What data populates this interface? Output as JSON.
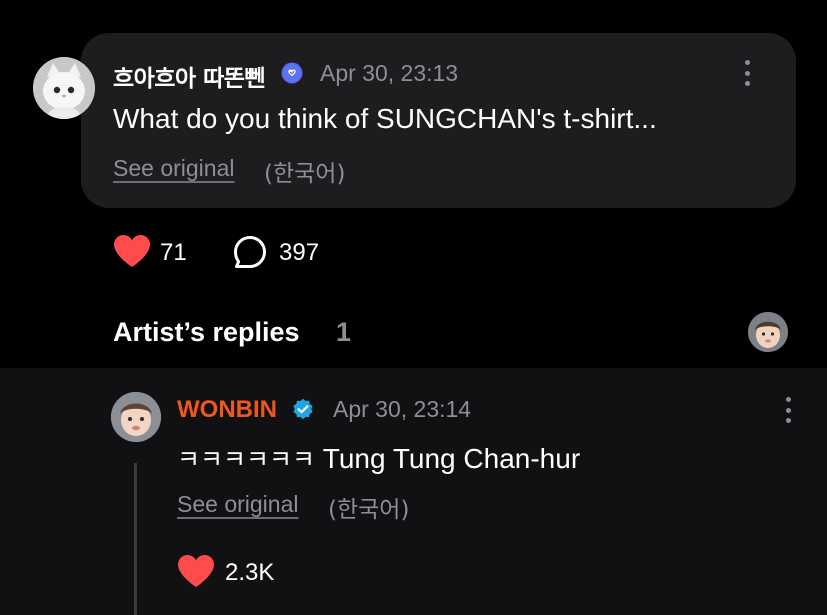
{
  "post": {
    "author": "흐아흐아 따똔뻰",
    "timestamp": "Apr 30, 23:13",
    "text": "What do you think of SUNGCHAN's t-shirt...",
    "see_original": "See original",
    "language_note": "(한국어)",
    "likes": "71",
    "comments": "397"
  },
  "replies_section": {
    "title": "Artist’s replies",
    "count": "1"
  },
  "reply": {
    "author": "WONBIN",
    "timestamp": "Apr 30, 23:14",
    "text_korean": "ㅋㅋㅋㅋㅋㅋ",
    "text_english": "Tung Tung Chan-hur",
    "see_original": "See original",
    "language_note": "(한국어)",
    "likes": "2.3K"
  },
  "colors": {
    "background": "#000000",
    "bubble": "#1d1d1f",
    "reply_panel": "#111113",
    "heart": "#ff4b4b",
    "artist_name": "#f0561d",
    "verified_badge": "#1fa6e0",
    "fan_badge": "#6b5cf2",
    "muted_text": "#8e8e93"
  },
  "icons": {
    "heart": "heart-icon",
    "comment": "comment-bubble-icon",
    "more": "more-vertical-icon",
    "verified": "verified-badge-icon"
  }
}
